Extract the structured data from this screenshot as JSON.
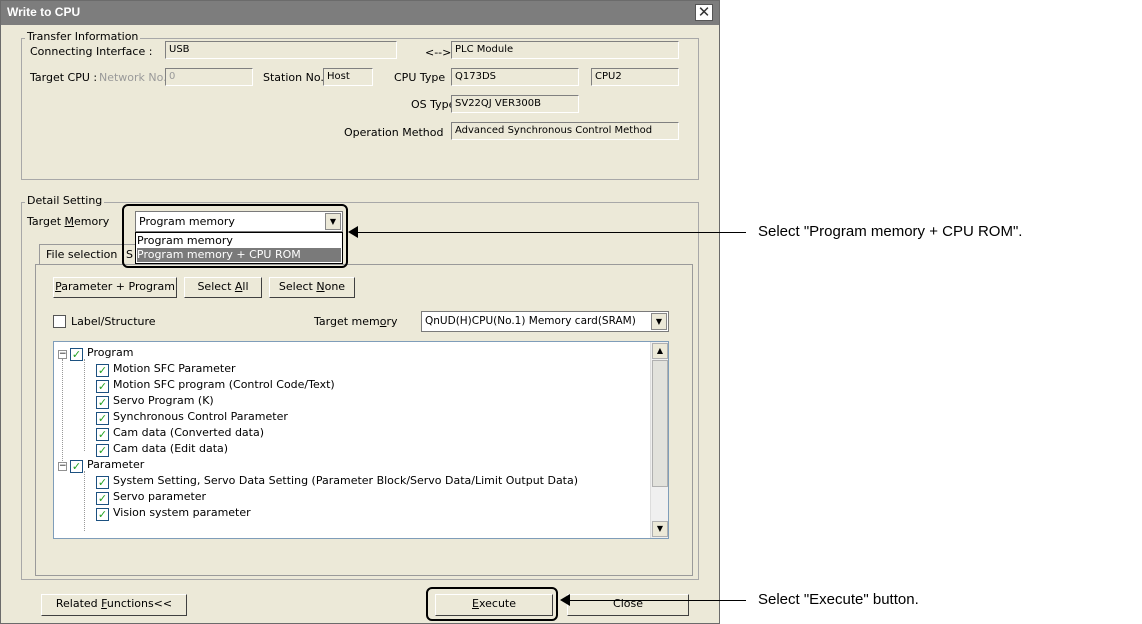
{
  "window": {
    "title": "Write to CPU"
  },
  "transfer": {
    "legend": "Transfer Information",
    "connecting_label": "Connecting Interface :",
    "connecting_value": "USB",
    "arrow_text": "<-->",
    "plc_value": "PLC Module",
    "target_cpu_label": "Target CPU :",
    "network_label": "Network No.",
    "network_value": "0",
    "station_label": "Station No.",
    "station_value": "Host",
    "cpu_type_label": "CPU Type",
    "cpu_type_value": "Q173DS",
    "cpu_no_value": "CPU2",
    "os_type_label": "OS Type",
    "os_type_value": "SV22QJ VER300B",
    "op_method_label": "Operation Method",
    "op_method_value": "Advanced Synchronous Control Method"
  },
  "detail": {
    "legend": "Detail Setting",
    "target_memory_label": "Target Memory",
    "target_memory_value": "Program memory",
    "dropdown_options": [
      "Program memory",
      "Program memory + CPU ROM"
    ],
    "tab_file_selection": "File selection",
    "tab_second_partial": "S",
    "btn_param_program": "Parameter + Program",
    "btn_select_all": "Select All",
    "btn_select_none": "Select None",
    "label_structure": "Label/Structure",
    "target_memory2_label": "Target memory",
    "target_memory2_value": "QnUD(H)CPU(No.1) Memory card(SRAM)"
  },
  "tree": {
    "program_label": "Program",
    "program_items": [
      "Motion SFC Parameter",
      "Motion SFC program (Control Code/Text)",
      "Servo Program (K)",
      "Synchronous Control Parameter",
      "Cam data (Converted data)",
      "Cam data (Edit data)"
    ],
    "parameter_label": "Parameter",
    "parameter_items": [
      "System Setting, Servo Data Setting (Parameter Block/Servo Data/Limit Output Data)",
      "Servo parameter",
      "Vision system parameter"
    ]
  },
  "footer": {
    "related_functions": "Related Functions<<",
    "execute": "Execute",
    "close": "Close"
  },
  "callouts": {
    "memory": "Select \"Program memory + CPU ROM\".",
    "execute": "Select \"Execute\" button."
  }
}
